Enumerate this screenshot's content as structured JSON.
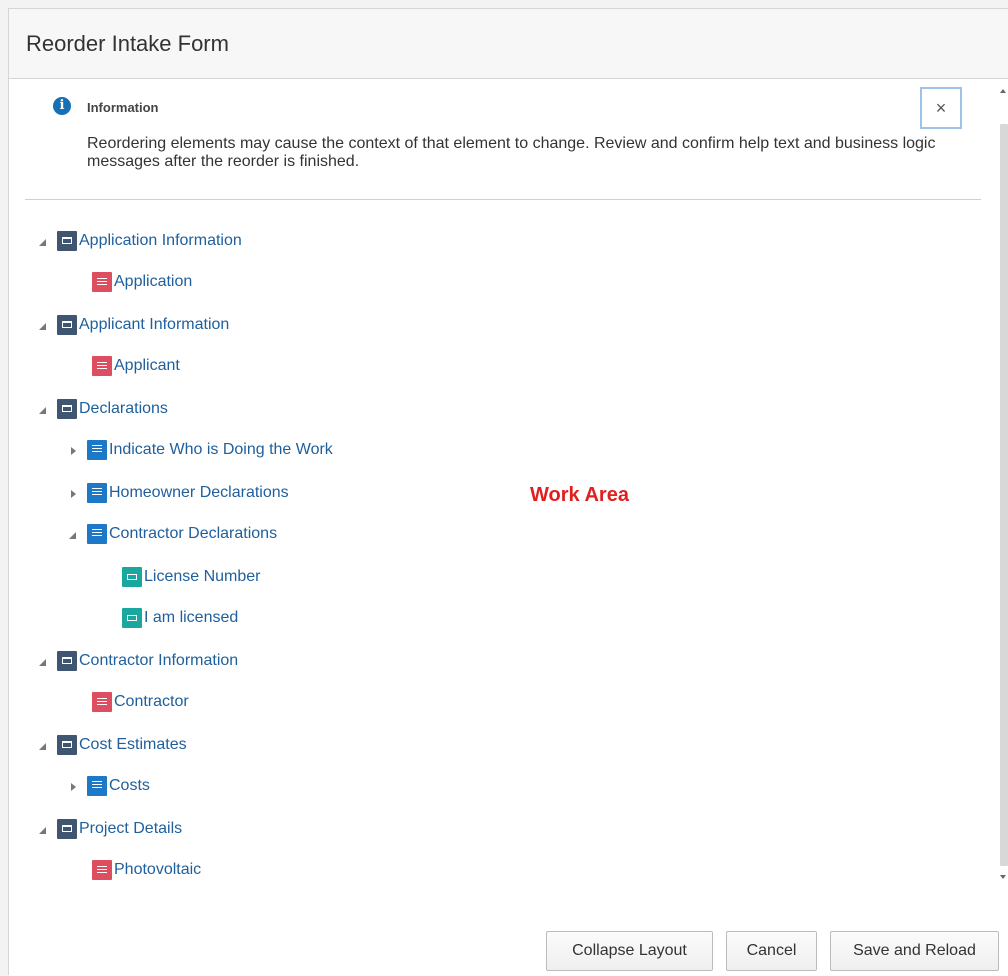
{
  "dialog": {
    "title": "Reorder Intake Form"
  },
  "info": {
    "title": "Information",
    "icon": "info-icon",
    "message": "Reordering elements may cause the context of that element to change. Review and confirm help text and business logic messages after the reorder is finished.",
    "close_glyph": "×"
  },
  "tree": [
    {
      "label": "Application Information",
      "icon": "folder-icon",
      "state": "expanded"
    },
    {
      "label": "Application",
      "icon": "record-icon"
    },
    {
      "label": "Applicant Information",
      "icon": "folder-icon",
      "state": "expanded"
    },
    {
      "label": "Applicant",
      "icon": "record-icon"
    },
    {
      "label": "Declarations",
      "icon": "folder-icon",
      "state": "expanded"
    },
    {
      "label": "Indicate Who is Doing the Work",
      "icon": "section-icon",
      "state": "collapsed"
    },
    {
      "label": "Homeowner Declarations",
      "icon": "section-icon",
      "state": "collapsed"
    },
    {
      "label": "Contractor Declarations",
      "icon": "section-icon",
      "state": "expanded"
    },
    {
      "label": "License Number",
      "icon": "field-icon"
    },
    {
      "label": "I am licensed",
      "icon": "field-icon"
    },
    {
      "label": "Contractor Information",
      "icon": "folder-icon",
      "state": "expanded"
    },
    {
      "label": "Contractor",
      "icon": "record-icon"
    },
    {
      "label": "Cost Estimates",
      "icon": "folder-icon",
      "state": "expanded"
    },
    {
      "label": "Costs",
      "icon": "section-icon",
      "state": "collapsed"
    },
    {
      "label": "Project Details",
      "icon": "folder-icon",
      "state": "expanded"
    },
    {
      "label": "Photovoltaic",
      "icon": "record-icon"
    }
  ],
  "overlay": {
    "work_area_label": "Work Area",
    "color": "#e02020"
  },
  "footer": {
    "collapse_label": "Collapse Layout",
    "cancel_label": "Cancel",
    "save_label": "Save and Reload"
  },
  "colors": {
    "link": "#1f5f9c",
    "folder": "#3f5570",
    "record": "#dd4f60",
    "section": "#1e78c8",
    "field": "#1aa7a0",
    "info": "#1670b3"
  }
}
